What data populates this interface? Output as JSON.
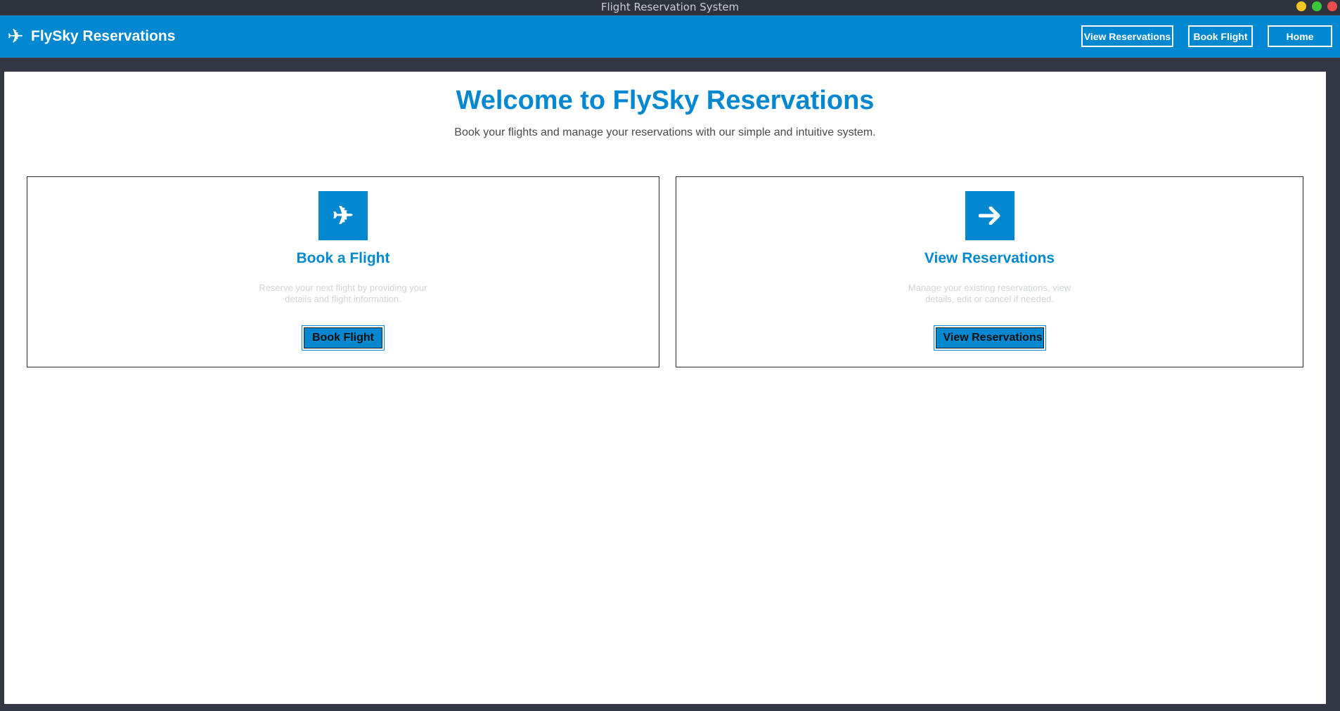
{
  "window": {
    "title": "Flight Reservation System"
  },
  "header": {
    "brand_icon": "airplane-icon",
    "brand_name": "FlySky Reservations",
    "nav": {
      "view_reservations": "View Reservations",
      "book_flight": "Book Flight",
      "home": "Home"
    }
  },
  "main": {
    "title": "Welcome to FlySky Reservations",
    "subtitle": "Book your flights and manage your reservations with our simple and intuitive system.",
    "cards": [
      {
        "icon": "airplane-icon",
        "title": "Book a Flight",
        "description": "Reserve your next flight by providing your details and flight information.",
        "button": "Book Flight"
      },
      {
        "icon": "arrow-right-icon",
        "title": "View Reservations",
        "description": "Manage your existing reservations, view details, edit or cancel if needed.",
        "button": "View Reservations"
      }
    ]
  },
  "colors": {
    "primary": "#0288d1",
    "window_bg": "#343845",
    "content_bg": "#ffffff",
    "muted_text": "#d0d3d8"
  }
}
